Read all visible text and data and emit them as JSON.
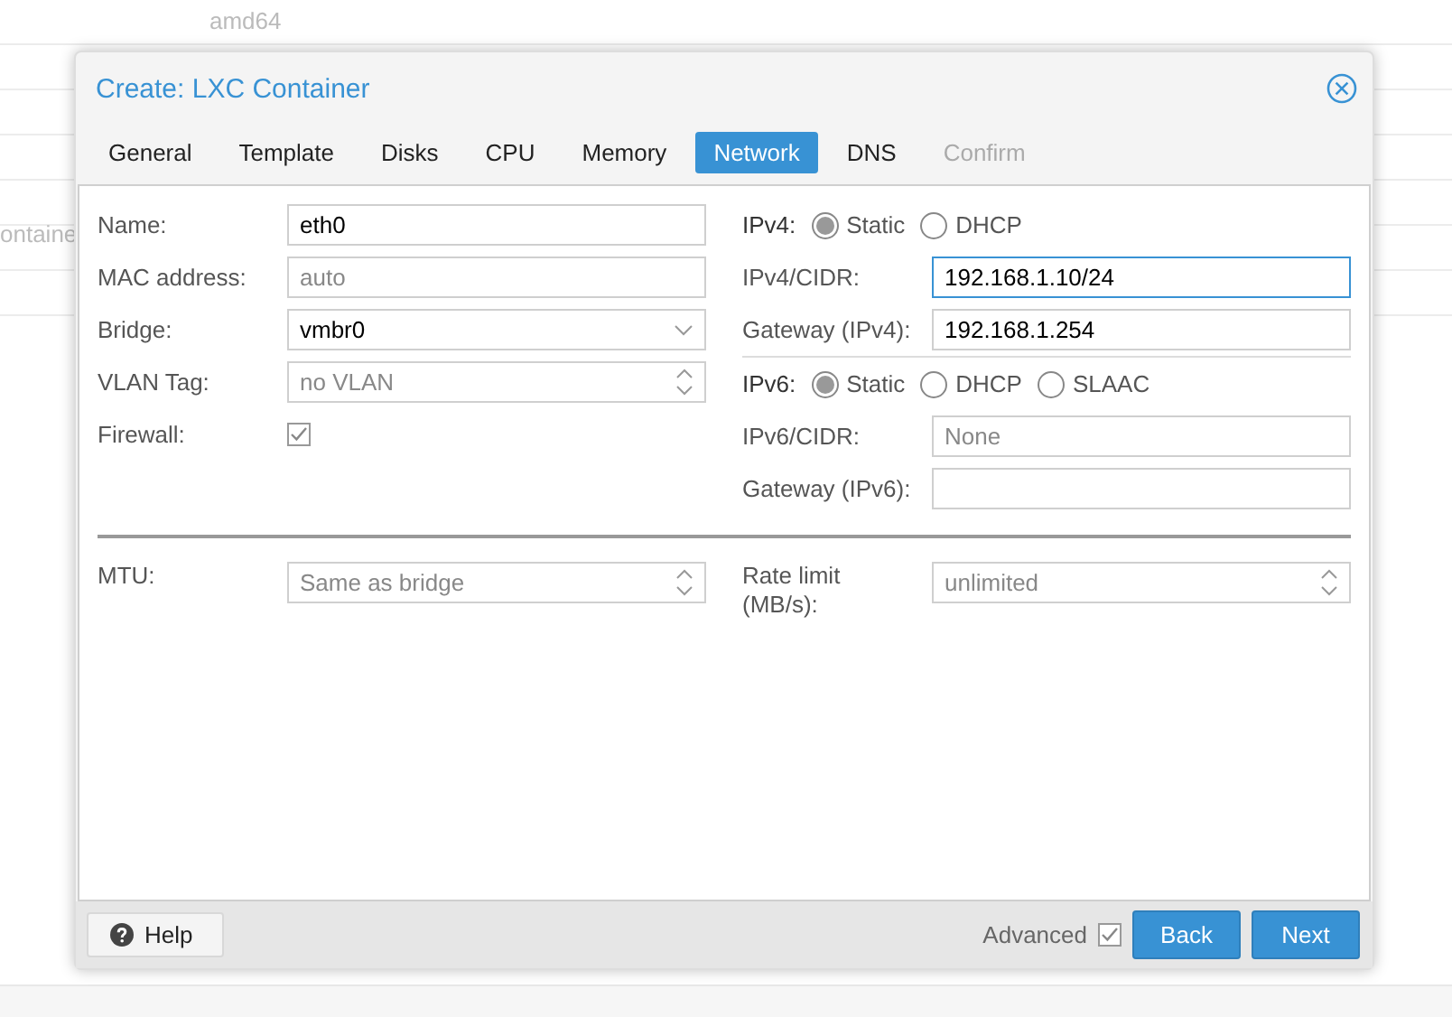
{
  "background": {
    "column_texts": [
      "amd64"
    ],
    "left_text": "ontaine"
  },
  "dialog": {
    "title": "Create: LXC Container",
    "tabs": [
      {
        "label": "General",
        "selected": false,
        "disabled": false
      },
      {
        "label": "Template",
        "selected": false,
        "disabled": false
      },
      {
        "label": "Disks",
        "selected": false,
        "disabled": false
      },
      {
        "label": "CPU",
        "selected": false,
        "disabled": false
      },
      {
        "label": "Memory",
        "selected": false,
        "disabled": false
      },
      {
        "label": "Network",
        "selected": true,
        "disabled": false
      },
      {
        "label": "DNS",
        "selected": false,
        "disabled": false
      },
      {
        "label": "Confirm",
        "selected": false,
        "disabled": true
      }
    ],
    "left_fields": [
      {
        "kind": "text",
        "label": "Name:",
        "value": "eth0"
      },
      {
        "kind": "text",
        "label": "MAC address:",
        "placeholder": "auto"
      },
      {
        "kind": "combo",
        "label": "Bridge:",
        "value": "vmbr0"
      },
      {
        "kind": "spinner",
        "label": "VLAN Tag:",
        "placeholder": "no VLAN"
      },
      {
        "kind": "checkbox",
        "label": "Firewall:",
        "checked": true
      }
    ],
    "right_sections": [
      {
        "label": "IPv4:",
        "options": [
          {
            "label": "Static",
            "selected": true
          },
          {
            "label": "DHCP",
            "selected": false
          }
        ],
        "fields": [
          {
            "kind": "text",
            "label": "IPv4/CIDR:",
            "value": "192.168.1.10/24",
            "focused": true
          },
          {
            "kind": "text",
            "label": "Gateway (IPv4):",
            "value": "192.168.1.254",
            "focused": false
          }
        ]
      },
      {
        "label": "IPv6:",
        "options": [
          {
            "label": "Static",
            "selected": true
          },
          {
            "label": "DHCP",
            "selected": false
          },
          {
            "label": "SLAAC",
            "selected": false
          }
        ],
        "fields": [
          {
            "kind": "text",
            "label": "IPv6/CIDR:",
            "placeholder": "None",
            "focused": false
          },
          {
            "kind": "text",
            "label": "Gateway (IPv6):",
            "focused": false
          }
        ]
      }
    ],
    "advanced_fields": [
      {
        "kind": "spinner",
        "label": "MTU:",
        "placeholder": "Same as bridge"
      },
      {
        "kind": "spinner",
        "label": "Rate limit (MB/s):",
        "placeholder": "unlimited"
      }
    ],
    "footer": {
      "help": "Help",
      "advanced": {
        "label": "Advanced",
        "checked": true
      },
      "buttons": [
        "Back",
        "Next"
      ]
    }
  }
}
